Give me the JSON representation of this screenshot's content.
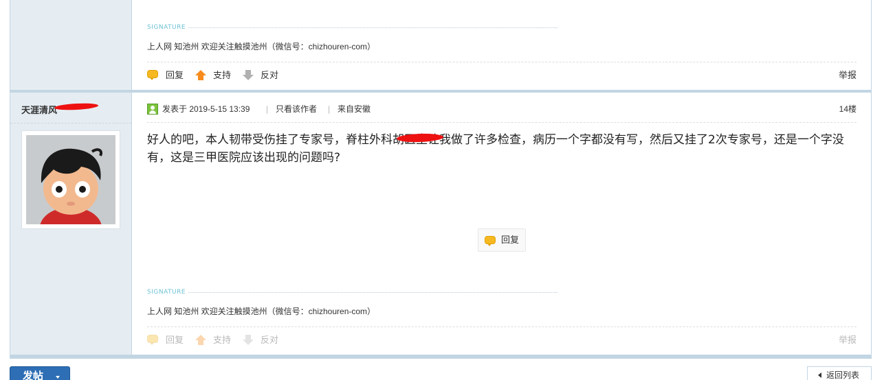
{
  "previous_post": {
    "signature_label": "SIGNATURE",
    "signature_text": "上人网 知池州 欢迎关注触摸池州（微信号：chizhouren-com）",
    "actions": {
      "reply": "回复",
      "support": "支持",
      "oppose": "反对",
      "report": "举报"
    }
  },
  "post": {
    "author": "天涯清风",
    "posted": "发表于 2019-5-15 13:39",
    "only_author": "只看该作者",
    "divider": "|",
    "from": "来自安徽",
    "floor": "14楼",
    "content": "好人的吧，本人韧带受伤挂了专家号，脊柱外科胡医生让我做了许多检查，病历一个字都没有写，然后又挂了2次专家号，还是一个字没有，这是三甲医院应该出现的问题吗?",
    "reply_button": "回复",
    "signature_label": "SIGNATURE",
    "signature_text": "上人网 知池州 欢迎关注触摸池州（微信号：chizhouren-com）",
    "actions": {
      "reply": "回复",
      "support": "支持",
      "oppose": "反对",
      "report": "举报"
    }
  },
  "footer": {
    "post_button": "发帖",
    "back_button": "返回列表"
  },
  "colors": {
    "side_bg": "#e5edf2",
    "border": "#c2d5e3",
    "accent_blue": "#2d6eb5",
    "redaction": "#ee1111"
  }
}
